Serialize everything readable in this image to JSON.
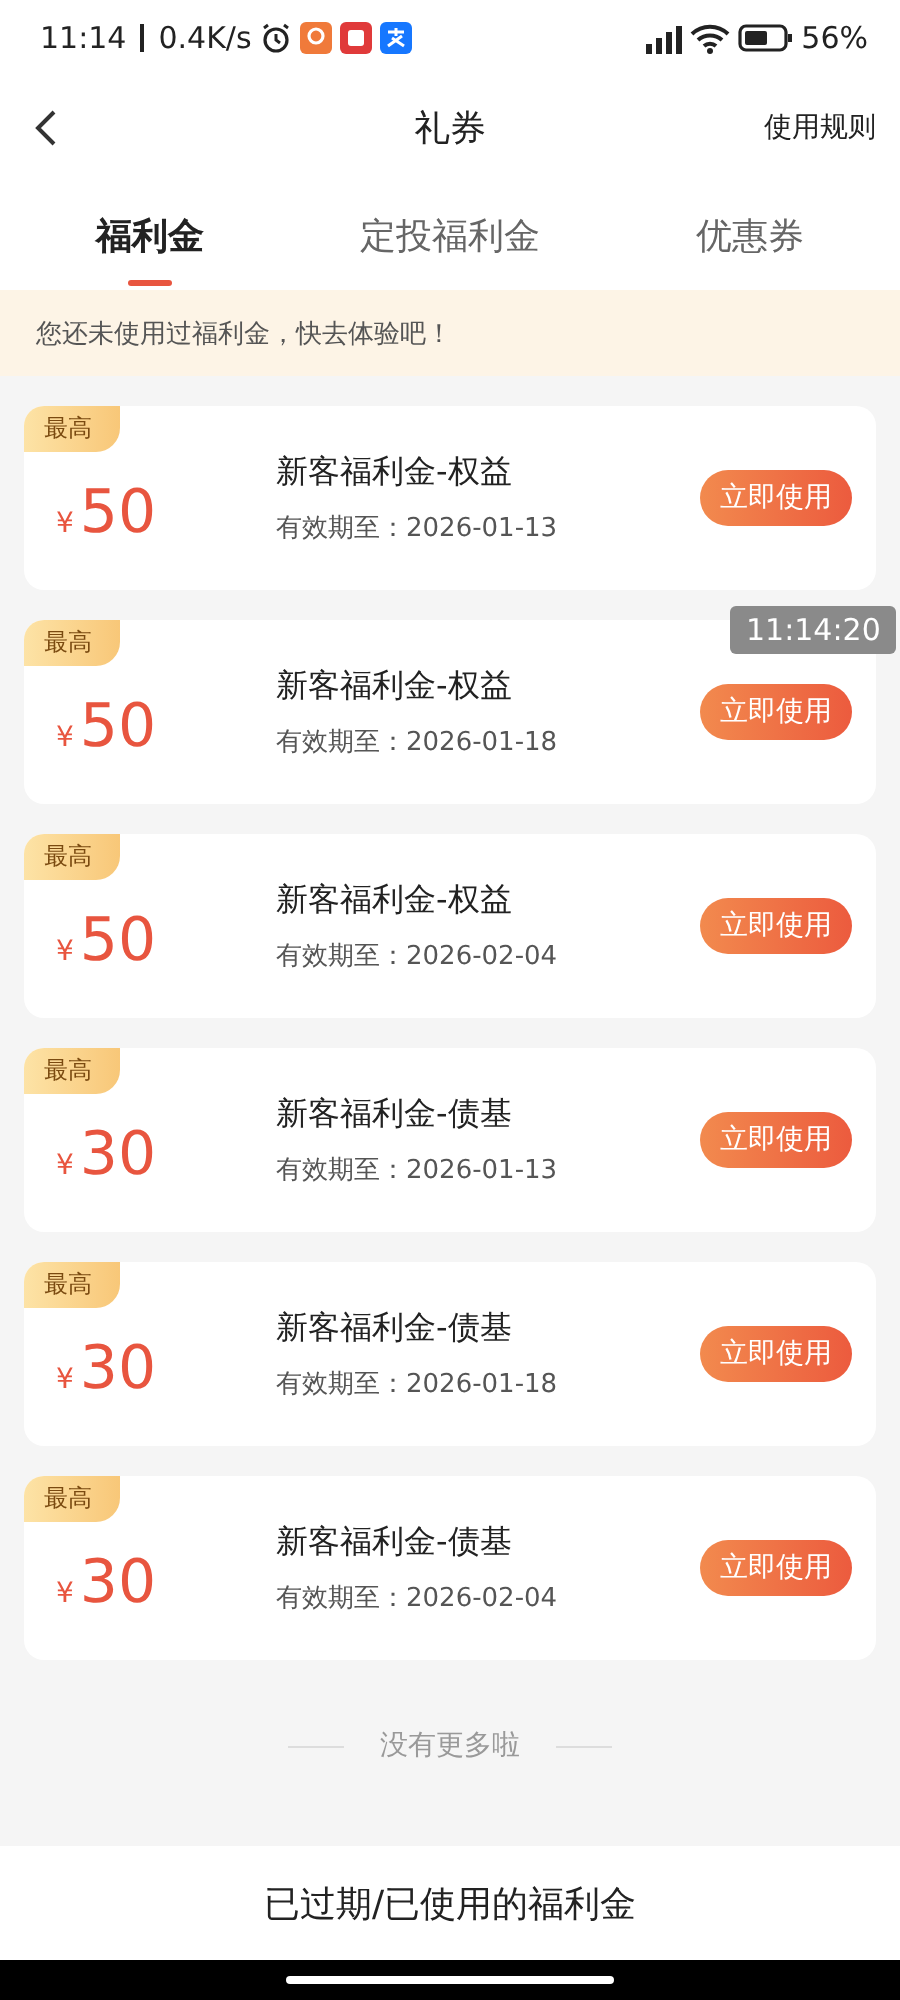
{
  "status_bar": {
    "time": "11:14",
    "speed": "0.4K/s",
    "battery": "56%"
  },
  "header": {
    "title": "礼券",
    "action": "使用规则"
  },
  "tabs": [
    {
      "label": "福利金",
      "selected": true
    },
    {
      "label": "定投福利金",
      "selected": false
    },
    {
      "label": "优惠券",
      "selected": false
    }
  ],
  "notice": "您还未使用过福利金，快去体验吧！",
  "coupons": [
    {
      "badge": "最高",
      "currency": "¥",
      "amount": "50",
      "title": "新客福利金-权益",
      "expiry": "有效期至：2026-01-13",
      "button": "立即使用"
    },
    {
      "badge": "最高",
      "currency": "¥",
      "amount": "50",
      "title": "新客福利金-权益",
      "expiry": "有效期至：2026-01-18",
      "button": "立即使用"
    },
    {
      "badge": "最高",
      "currency": "¥",
      "amount": "50",
      "title": "新客福利金-权益",
      "expiry": "有效期至：2026-02-04",
      "button": "立即使用"
    },
    {
      "badge": "最高",
      "currency": "¥",
      "amount": "30",
      "title": "新客福利金-债基",
      "expiry": "有效期至：2026-01-13",
      "button": "立即使用"
    },
    {
      "badge": "最高",
      "currency": "¥",
      "amount": "30",
      "title": "新客福利金-债基",
      "expiry": "有效期至：2026-01-18",
      "button": "立即使用"
    },
    {
      "badge": "最高",
      "currency": "¥",
      "amount": "30",
      "title": "新客福利金-债基",
      "expiry": "有效期至：2026-02-04",
      "button": "立即使用"
    }
  ],
  "end_text": "没有更多啦",
  "footer_link": "已过期/已使用的福利金",
  "floating_clock": "11:14:20"
}
